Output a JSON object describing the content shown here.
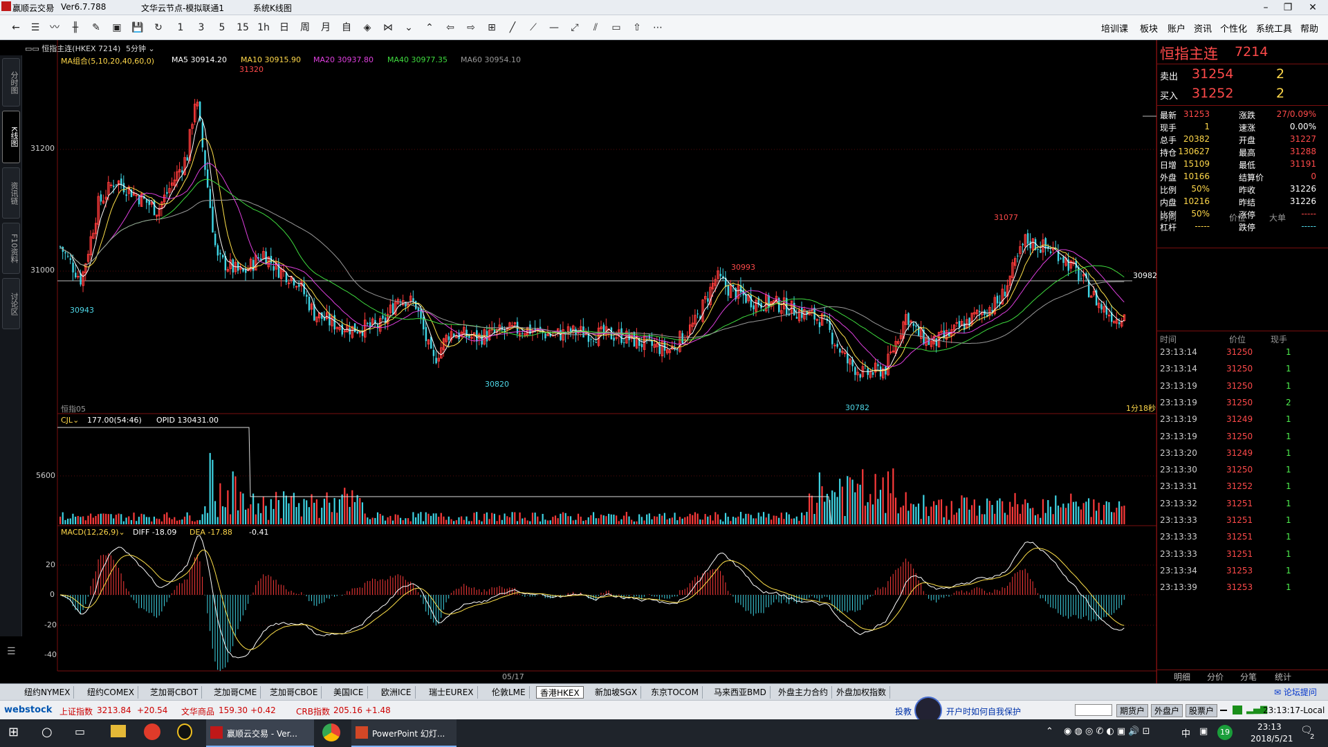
{
  "window": {
    "app_title": "赢顺云交易",
    "version": "Ver6.7.788",
    "node": "文华云节点-模拟联通1",
    "kline_label": "系统K线图",
    "min_icon": "minimize-icon",
    "restore_icon": "restore-icon",
    "close_icon": "close-icon"
  },
  "toolbar": {
    "icons": [
      "back-icon",
      "list-icon",
      "line-chart-icon",
      "candle-icon",
      "draw-icon",
      "save-template-icon",
      "save-icon",
      "refresh-icon"
    ],
    "periods": [
      "1",
      "3",
      "5",
      "15",
      "1h",
      "日",
      "周",
      "月",
      "自"
    ],
    "right_menu": [
      "培训课",
      "板块",
      "账户",
      "资讯",
      "个性化",
      "系统工具",
      "帮助"
    ]
  },
  "left_tabs": [
    "分时图",
    "K线图",
    "资讯链",
    "F10资料",
    "讨论区"
  ],
  "chart_header": {
    "symbol": "恒指主连(HKEX 7214)",
    "period": "5分钟",
    "ma_title": "MA组合(5,10,20,40,60,0)",
    "ma5": "MA5 30914.20",
    "ma10": "MA10 30915.90",
    "ma20": "MA20 30937.80",
    "ma40": "MA40 30977.35",
    "ma60": "MA60 30954.10"
  },
  "price_axis": {
    "p31200": "31200",
    "p31000": "31000"
  },
  "price_labels": {
    "high1": "31320",
    "low1": "30943",
    "low2": "30820",
    "high2": "30993",
    "low3": "30782",
    "high3": "31077",
    "current": "30982"
  },
  "chart_footer": {
    "left_tag": "恒指05",
    "countdown": "1分18秒",
    "date": "05/17"
  },
  "volume": {
    "title": "CJL",
    "value": "177.00(54:46)",
    "opid": "OPID 130431.00",
    "axis_5600": "5600"
  },
  "macd": {
    "title": "MACD(12,26,9)",
    "diff": "DIFF -18.09",
    "dea": "DEA -17.88",
    "macd_val": "-0.41",
    "axis": [
      "20",
      "0",
      "-20",
      "-40"
    ]
  },
  "quote": {
    "name": "恒指主连",
    "code": "7214",
    "sell_label": "卖出",
    "sell_price": "31254",
    "sell_qty": "2",
    "buy_label": "买入",
    "buy_price": "31252",
    "buy_qty": "2",
    "rows": [
      {
        "l1": "最新",
        "v1": "31253",
        "l2": "涨跌",
        "v2": "27/0.09%",
        "c1": "red",
        "c2": "red"
      },
      {
        "l1": "现手",
        "v1": "1",
        "l2": "速涨",
        "v2": "0.00%",
        "c1": "yellow",
        "c2": "white"
      },
      {
        "l1": "总手",
        "v1": "20382",
        "l2": "开盘",
        "v2": "31227",
        "c1": "yellow",
        "c2": "red"
      },
      {
        "l1": "持仓",
        "v1": "130627",
        "l2": "最高",
        "v2": "31288",
        "c1": "yellow",
        "c2": "red"
      },
      {
        "l1": "日增",
        "v1": "15109",
        "l2": "最低",
        "v2": "31191",
        "c1": "yellow",
        "c2": "red"
      },
      {
        "l1": "外盘",
        "v1": "10166",
        "l2": "结算价",
        "v2": "0",
        "c1": "yellow",
        "c2": "red"
      },
      {
        "l1": "比例",
        "v1": "50%",
        "l2": "昨收",
        "v2": "31226",
        "c1": "yellow",
        "c2": "white"
      },
      {
        "l1": "内盘",
        "v1": "10216",
        "l2": "昨结",
        "v2": "31226",
        "c1": "yellow",
        "c2": "white"
      },
      {
        "l1": "比例",
        "v1": "50%",
        "l2": "涨停",
        "v2": "-----",
        "c1": "yellow",
        "c2": "red"
      },
      {
        "l1": "杠杆",
        "v1": "-----",
        "l2": "跌停",
        "v2": "-----",
        "c1": "yellow",
        "c2": "cyan"
      }
    ],
    "big_header": {
      "time": "时间",
      "price": "价位",
      "big": "大单"
    },
    "tick_header": {
      "time": "时间",
      "price": "价位",
      "qty": "现手"
    },
    "ticks": [
      {
        "t": "23:13:14",
        "p": "31250",
        "q": "1"
      },
      {
        "t": "23:13:14",
        "p": "31250",
        "q": "1"
      },
      {
        "t": "23:13:19",
        "p": "31250",
        "q": "1"
      },
      {
        "t": "23:13:19",
        "p": "31250",
        "q": "2"
      },
      {
        "t": "23:13:19",
        "p": "31249",
        "q": "1"
      },
      {
        "t": "23:13:19",
        "p": "31250",
        "q": "1"
      },
      {
        "t": "23:13:20",
        "p": "31249",
        "q": "1"
      },
      {
        "t": "23:13:30",
        "p": "31250",
        "q": "1"
      },
      {
        "t": "23:13:31",
        "p": "31252",
        "q": "1"
      },
      {
        "t": "23:13:32",
        "p": "31251",
        "q": "1"
      },
      {
        "t": "23:13:33",
        "p": "31251",
        "q": "1"
      },
      {
        "t": "23:13:33",
        "p": "31251",
        "q": "1"
      },
      {
        "t": "23:13:33",
        "p": "31251",
        "q": "1"
      },
      {
        "t": "23:13:34",
        "p": "31253",
        "q": "1"
      },
      {
        "t": "23:13:39",
        "p": "31253",
        "q": "1"
      }
    ],
    "bottom_tabs": [
      "明细",
      "分价",
      "分笔",
      "统计"
    ]
  },
  "market_tabs": [
    "纽约NYMEX",
    "纽约COMEX",
    "芝加哥CBOT",
    "芝加哥CME",
    "芝加哥CBOE",
    "美国ICE",
    "欧洲ICE",
    "瑞士EUREX",
    "伦敦LME",
    "香港HKEX",
    "新加坡SGX",
    "东京TOCOM",
    "马来西亚BMD",
    "外盘主力合约",
    "外盘加权指数"
  ],
  "active_market": "香港HKEX",
  "forum_link": "论坛提问",
  "status": {
    "logo": "webstock",
    "sh_label": "上证指数",
    "sh_val": "3213.84",
    "sh_chg": "+20.54",
    "wh_label": "文华商品",
    "wh_val": "159.30",
    "wh_chg": "+0.42",
    "crb_label": "CRB指数",
    "crb_val": "205.16",
    "crb_chg": "+1.48",
    "ad_text": "投教",
    "ad_text2": "开户时如何自我保护",
    "btns": [
      "期货户",
      "外盘户",
      "股票户"
    ],
    "clock": "23:13:17-Local"
  },
  "taskbar": {
    "task1": "赢顺云交易 - Ver...",
    "task2": "PowerPoint 幻灯...",
    "ime": "中",
    "badge": "19",
    "time": "23:13",
    "date": "2018/5/21",
    "notif": "2"
  },
  "colors": {
    "up": "#ff3b3b",
    "down": "#3fd6e6",
    "ma5": "#ffffff",
    "ma10": "#ffe14a",
    "ma20": "#e040e0",
    "ma40": "#3fdc3f",
    "ma60": "#9a9a9a"
  }
}
